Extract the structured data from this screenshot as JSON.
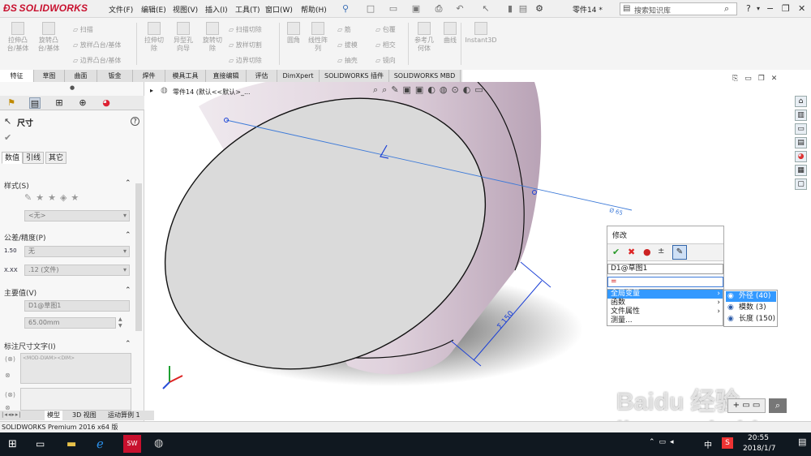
{
  "app": {
    "logo_text": "SOLIDWORKS",
    "menu": [
      "文件(F)",
      "编辑(E)",
      "视图(V)",
      "插入(I)",
      "工具(T)",
      "窗口(W)",
      "帮助(H)"
    ],
    "document_name": "零件14 *",
    "search_placeholder": "搜索知识库",
    "help_label": "?"
  },
  "command_manager": {
    "groups": [
      {
        "label": "拉伸凸\n台/基体"
      },
      {
        "label": "旋转凸\n台/基体"
      },
      {
        "label": "扫描"
      },
      {
        "label": "放样凸台/基体"
      },
      {
        "label": "边界凸台/基体"
      },
      {
        "label": "拉伸切\n除"
      },
      {
        "label": "异型孔\n向导"
      },
      {
        "label": "旋转切\n除"
      },
      {
        "label": "扫描切除"
      },
      {
        "label": "放样切割"
      },
      {
        "label": "边界切除"
      },
      {
        "label": "圆角"
      },
      {
        "label": "线性阵\n列"
      },
      {
        "label": "筋"
      },
      {
        "label": "拔模"
      },
      {
        "label": "抽壳"
      },
      {
        "label": "包覆"
      },
      {
        "label": "相交"
      },
      {
        "label": "镜向"
      },
      {
        "label": "参考几\n何体"
      },
      {
        "label": "曲线"
      },
      {
        "label": "Instant3D"
      }
    ]
  },
  "tabs": [
    "特征",
    "草图",
    "曲面",
    "钣金",
    "焊件",
    "模具工具",
    "直接编辑",
    "评估",
    "DimXpert",
    "SOLIDWORKS 插件",
    "SOLIDWORKS MBD"
  ],
  "property_manager": {
    "title": "尺寸",
    "help": "?",
    "subtabs": [
      "数值",
      "引线",
      "其它"
    ],
    "style_section": "样式(S)",
    "style_value": "<无>",
    "tolerance_section": "公差/精度(P)",
    "tolerance_type": "无",
    "precision": ".12 (文件)",
    "tol_icon_text": "1.50",
    "prec_icon_text": "X.XX",
    "primary_section": "主要值(V)",
    "primary_name": "D1@草图1",
    "primary_value": "65.00mm",
    "dimtext_section": "标注尺寸文字(I)",
    "dimtext_value": "<MOD-DIAM><DIM>"
  },
  "feature_tree": {
    "item": "零件14 (默认<<默认>_..."
  },
  "viewport": {
    "dim_diameter_label": "Ø 65",
    "dim_length_label": "Σ 150"
  },
  "modify_dialog": {
    "title": "修改",
    "dimension_name": "D1@草图1",
    "input_value": "="
  },
  "context_menu": {
    "items": [
      "全局变量",
      "函数",
      "文件属性",
      "测量..."
    ]
  },
  "submenu": {
    "items": [
      "外径 (40)",
      "模数 (3)",
      "长度 (150)"
    ]
  },
  "bottom_tabs": [
    "模型",
    "3D 视图",
    "运动算例 1"
  ],
  "status_text": "SOLIDWORKS Premium 2016 x64 版",
  "taskbar": {
    "time": "20:55",
    "date": "2018/1/7",
    "ime": "中"
  },
  "watermark": "Baidu 经验 jingyan.baidu.com",
  "colors": {
    "brand_red": "#c8102e",
    "selection_blue": "#3399ff",
    "dim_blue": "#1a3fd6",
    "cylinder_side": "#c8b9c6",
    "cylinder_face": "#d9d9d9"
  }
}
